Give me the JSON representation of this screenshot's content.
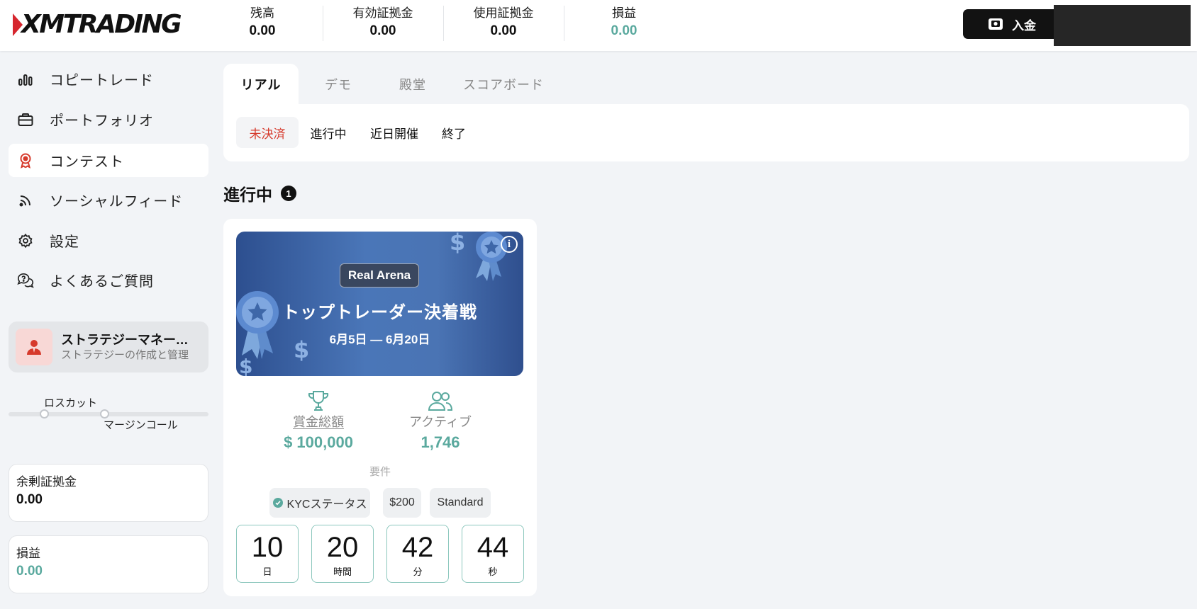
{
  "header": {
    "logo": "XMTRADING",
    "stats": [
      {
        "label": "残高",
        "value": "0.00"
      },
      {
        "label": "有効証拠金",
        "value": "0.00"
      },
      {
        "label": "使用証拠金",
        "value": "0.00"
      },
      {
        "label": "損益",
        "value": "0.00"
      }
    ],
    "deposit_label": "入金"
  },
  "sidebar": {
    "items": [
      {
        "label": "コピートレード",
        "icon": "bar-chart-icon"
      },
      {
        "label": "ポートフォリオ",
        "icon": "briefcase-icon"
      },
      {
        "label": "コンテスト",
        "icon": "award-icon"
      },
      {
        "label": "ソーシャルフィード",
        "icon": "rss-icon"
      },
      {
        "label": "設定",
        "icon": "gear-icon"
      },
      {
        "label": "よくあるご質問",
        "icon": "chat-question-icon"
      }
    ],
    "active_index": 2,
    "strategy_manager": {
      "title": "ストラテジーマネージャー",
      "subtitle": "ストラテジーの作成と管理"
    },
    "margin_labels": {
      "stop_out": "ロスカット",
      "margin_call": "マージンコール"
    },
    "free_margin": {
      "label": "余剰証拠金",
      "value": "0.00"
    },
    "pnl": {
      "label": "損益",
      "value": "0.00"
    }
  },
  "tabs": {
    "top": [
      "リアル",
      "デモ",
      "殿堂",
      "スコアボード"
    ],
    "active_top": 0,
    "sub": [
      "未決済",
      "進行中",
      "近日開催",
      "終了"
    ],
    "active_sub": 0
  },
  "section": {
    "title": "進行中",
    "count": "1"
  },
  "contest": {
    "tag": "Real Arena",
    "title": "トップトレーダー決着戦",
    "dates": "6月5日 ― 6月20日",
    "prize_label": "賞金総額",
    "prize_value": "$ 100,000",
    "active_label": "アクティブ",
    "active_value": "1,746",
    "requirements_label": "要件",
    "requirements": [
      "KYCステータス",
      "$200",
      "Standard"
    ],
    "countdown": [
      {
        "value": "10",
        "unit": "日"
      },
      {
        "value": "20",
        "unit": "時間"
      },
      {
        "value": "42",
        "unit": "分"
      },
      {
        "value": "44",
        "unit": "秒"
      }
    ]
  },
  "colors": {
    "accent_green": "#5aa99e",
    "accent_red": "#d63a2c",
    "brand_red": "#d6262e"
  }
}
